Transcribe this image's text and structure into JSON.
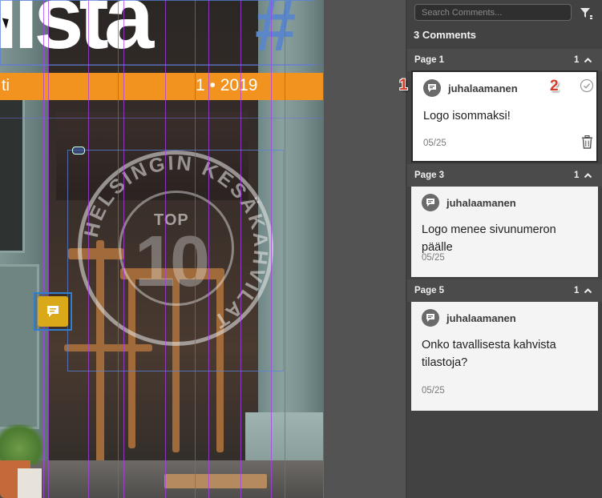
{
  "canvas": {
    "masthead": "lista",
    "masthead_hash": "#",
    "band_left": "ti",
    "band_right": "1 • 2019",
    "stamp_top": "TOP",
    "stamp_number": "10",
    "stamp_ring_text": "HELSINGIN KESÄKAHVILAT"
  },
  "panel": {
    "search_placeholder": "Search Comments...",
    "comment_count": "3 Comments",
    "sections": [
      {
        "title": "Page 1",
        "count": "1",
        "comment": {
          "author": "juhalaamanen",
          "text": "Logo isommaksi!",
          "date": "05/25"
        }
      },
      {
        "title": "Page 3",
        "count": "1",
        "comment": {
          "author": "juhalaamanen",
          "text": "Logo menee sivunumeron päälle",
          "date": "05/25"
        }
      },
      {
        "title": "Page 5",
        "count": "1",
        "comment": {
          "author": "juhalaamanen",
          "text": "Onko tavallisesta kahvista tilastoja?",
          "date": "05/25"
        }
      }
    ]
  },
  "callouts": {
    "first": "1",
    "second": "2"
  },
  "colors": {
    "accent_orange": "#f2931f",
    "pin_yellow": "#d9a91a",
    "selection_blue": "#2f7fd0",
    "callout_red": "#d83a2a"
  },
  "icons": [
    "comment-pin-icon",
    "filter-icon",
    "chevron-up-icon",
    "checkmark-circle-icon",
    "trash-icon",
    "comment-bubble-icon",
    "arrow-cursor-icon",
    "link-icon"
  ]
}
